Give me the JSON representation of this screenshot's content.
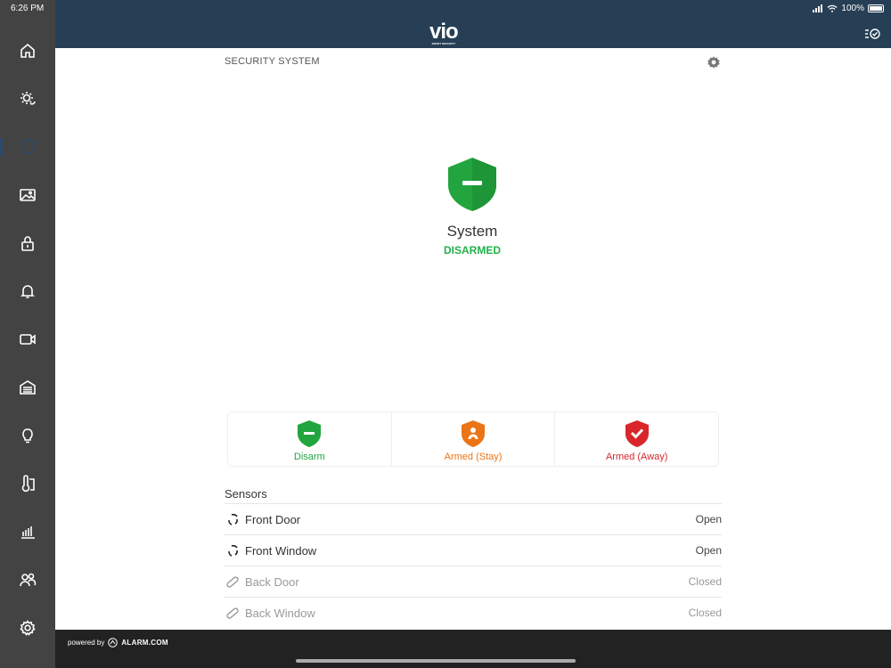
{
  "status_bar": {
    "time": "6:26 PM",
    "battery": "100%"
  },
  "sidebar": {
    "items": [
      {
        "name": "home"
      },
      {
        "name": "scenes"
      },
      {
        "name": "security",
        "active": true
      },
      {
        "name": "images"
      },
      {
        "name": "locks"
      },
      {
        "name": "notifications"
      },
      {
        "name": "video"
      },
      {
        "name": "garage"
      },
      {
        "name": "lights"
      },
      {
        "name": "thermostat"
      },
      {
        "name": "energy"
      },
      {
        "name": "users"
      },
      {
        "name": "settings"
      }
    ]
  },
  "header": {
    "logo": "vio",
    "logo_tagline": "SMART SECURITY",
    "title": "SECURITY SYSTEM"
  },
  "system": {
    "name": "System",
    "state": "DISARMED",
    "state_color": "#22b14c"
  },
  "arm_buttons": [
    {
      "label": "Disarm",
      "color": "#22a53f"
    },
    {
      "label": "Armed (Stay)",
      "color": "#ea7416"
    },
    {
      "label": "Armed (Away)",
      "color": "#d8262b"
    }
  ],
  "sensors": {
    "title": "Sensors",
    "items": [
      {
        "name": "Front Door",
        "status": "Open"
      },
      {
        "name": "Front Window",
        "status": "Open"
      },
      {
        "name": "Back Door",
        "status": "Closed"
      },
      {
        "name": "Back Window",
        "status": "Closed"
      }
    ]
  },
  "footer": {
    "powered_by": "powered by",
    "brand": "ALARM.COM"
  }
}
